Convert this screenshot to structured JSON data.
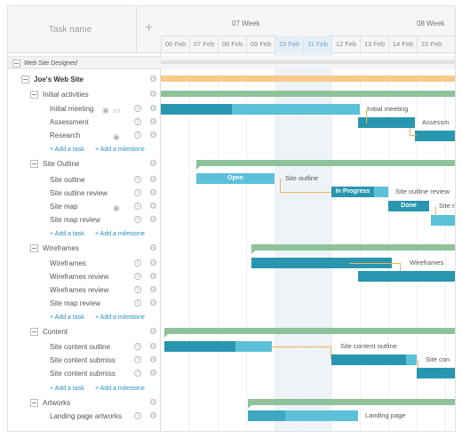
{
  "grid": {
    "header_title": "Task name",
    "add_icon": "plus-icon",
    "rows": [
      {
        "label": "Web Site Designed"
      },
      {
        "label": "Joe's Web Site"
      },
      {
        "label": "Initial activities"
      },
      {
        "label": "Initial meeting"
      },
      {
        "label": "Assessment"
      },
      {
        "label": "Research"
      },
      {
        "add_task": "+ Add a task",
        "add_milestone": "+ Add a milestone"
      },
      {
        "label": "Site Outline"
      },
      {
        "label": "Site outline"
      },
      {
        "label": "Site outline review"
      },
      {
        "label": "Site map"
      },
      {
        "label": "Site map review"
      },
      {
        "add_task": "+ Add a task",
        "add_milestone": "+ Add a milestone"
      },
      {
        "label": "Wireframes"
      },
      {
        "label": "Wireframes"
      },
      {
        "label": "Wireframes review"
      },
      {
        "label": "Wireframes review"
      },
      {
        "label": "Site map review"
      },
      {
        "add_task": "+ Add a task",
        "add_milestone": "+ Add a milestone"
      },
      {
        "label": "Content"
      },
      {
        "label": "Site content outline"
      },
      {
        "label": "Site content submiss"
      },
      {
        "label": "Site content submiss"
      },
      {
        "add_task": "+ Add a task",
        "add_milestone": "+ Add a milestone"
      },
      {
        "label": "Artworks"
      },
      {
        "label": "Landing page artworks"
      }
    ]
  },
  "timeline": {
    "weeks": [
      "07 Week",
      "08 Week"
    ],
    "days": [
      "06 Feb",
      "07 Feb",
      "08 Feb",
      "09 Feb",
      "10 Feb",
      "11 Feb",
      "12 Feb",
      "13 Feb",
      "14 Feb",
      "15 Feb"
    ],
    "highlight_days": [
      "10 Feb",
      "11 Feb"
    ],
    "bar_labels": {
      "initial_meeting": "Initial meeting",
      "assessment": "Assessm",
      "site_outline_status": "Open",
      "site_outline": "Site outline",
      "site_outline_review_status": "In Progress",
      "site_outline_review": "Site outline review",
      "site_map_status": "Done",
      "site_map": "Site m",
      "wireframes": "Wireframes",
      "site_content_outline": "Site content outline",
      "site_content_submission": "Site con",
      "landing_page": "Landing page"
    }
  },
  "colors": {
    "task_bar": "#5bc0d8",
    "task_progress": "#2996b0",
    "summary_bar": "#8ec29a",
    "project_bar": "#f7c98a",
    "link_line": "#f0b35a",
    "accent_link": "#2a8fc4"
  }
}
